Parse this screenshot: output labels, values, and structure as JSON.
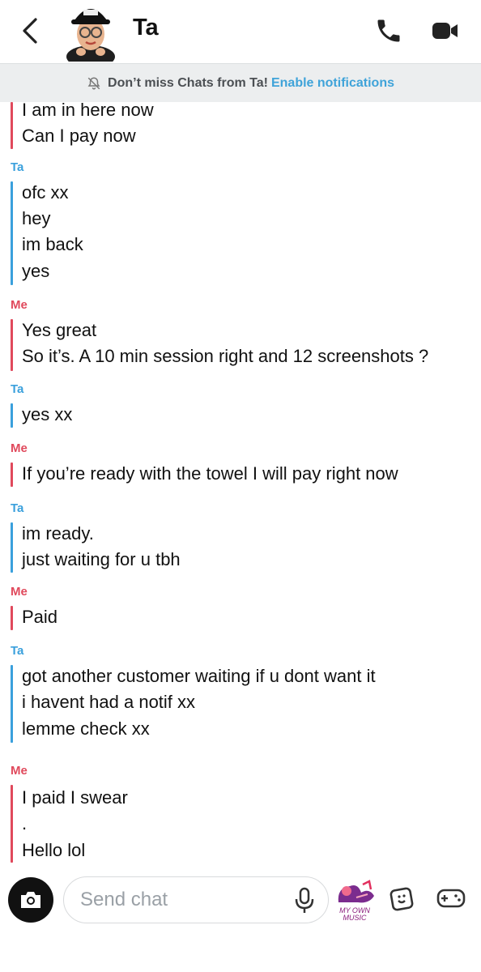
{
  "header": {
    "title": "Ta",
    "icons": {
      "back": "chevron-left-icon",
      "call": "phone-icon",
      "video": "video-camera-icon"
    }
  },
  "notification": {
    "text": "Don’t miss Chats from Ta!",
    "link": "Enable notifications",
    "icon": "bell-off-icon"
  },
  "messages": [
    {
      "sender": "",
      "lines": [
        "I am in here now",
        "Can I pay now"
      ]
    },
    {
      "sender": "Ta",
      "lines": [
        "ofc xx",
        "hey",
        "im back",
        "yes"
      ]
    },
    {
      "sender": "Me",
      "lines": [
        "Yes great",
        "So it’s. A 10 min session right and 12 screenshots ?"
      ]
    },
    {
      "sender": "Ta",
      "lines": [
        "yes xx"
      ]
    },
    {
      "sender": "Me",
      "lines": [
        "If you’re ready with the towel I will pay right now"
      ]
    },
    {
      "sender": "Ta",
      "lines": [
        "im ready.",
        "just waiting for u tbh"
      ]
    },
    {
      "sender": "Me",
      "lines": [
        "Paid"
      ]
    },
    {
      "sender": "Ta",
      "lines": [
        "got another customer waiting if u dont want it",
        "i havent had a notif xx",
        "lemme check xx"
      ]
    },
    {
      "sender": "Me",
      "lines": [
        "I paid I swear",
        ".",
        "Hello lol"
      ]
    }
  ],
  "composer": {
    "placeholder": "Send chat",
    "music_label_line1": "MY OWN",
    "music_label_line2": "MUSIC",
    "icons": {
      "camera": "camera-icon",
      "mic": "microphone-icon",
      "music": "music-sticker-icon",
      "sticker": "sticker-icon",
      "games": "game-controller-icon"
    }
  },
  "colors": {
    "me": "#e0495c",
    "ta": "#3aa0dc",
    "link": "#3fa3d9"
  }
}
